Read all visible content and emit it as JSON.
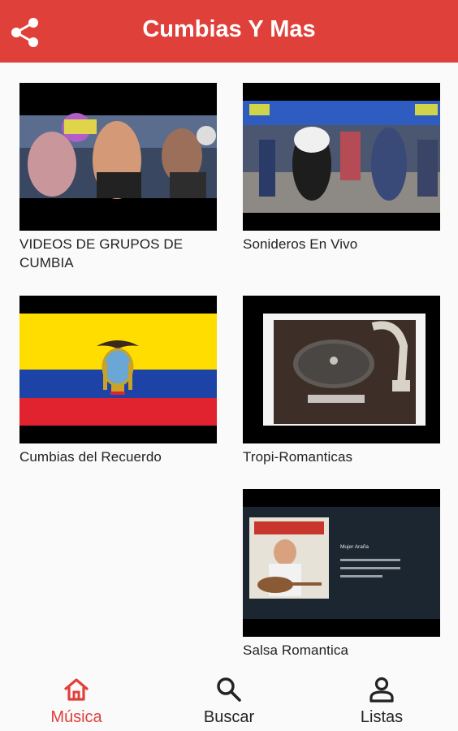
{
  "app": {
    "title": "Cumbias Y Mas",
    "accent": "#e0403a"
  },
  "header": {
    "share_icon": "share-icon"
  },
  "grid": {
    "items": [
      {
        "label": "VIDEOS DE GRUPOS DE CUMBIA"
      },
      {
        "label": "Sonideros En Vivo"
      },
      {
        "label": "Cumbias del Recuerdo"
      },
      {
        "label": "Tropi-Romanticas"
      },
      {
        "label": "Salsa Romantica"
      }
    ],
    "album": {
      "title": "Mujer Araña"
    }
  },
  "bottom_nav": {
    "items": [
      {
        "label": "Música",
        "icon": "home-icon",
        "active": true
      },
      {
        "label": "Buscar",
        "icon": "search-icon",
        "active": false
      },
      {
        "label": "Listas",
        "icon": "person-icon",
        "active": false
      }
    ]
  }
}
